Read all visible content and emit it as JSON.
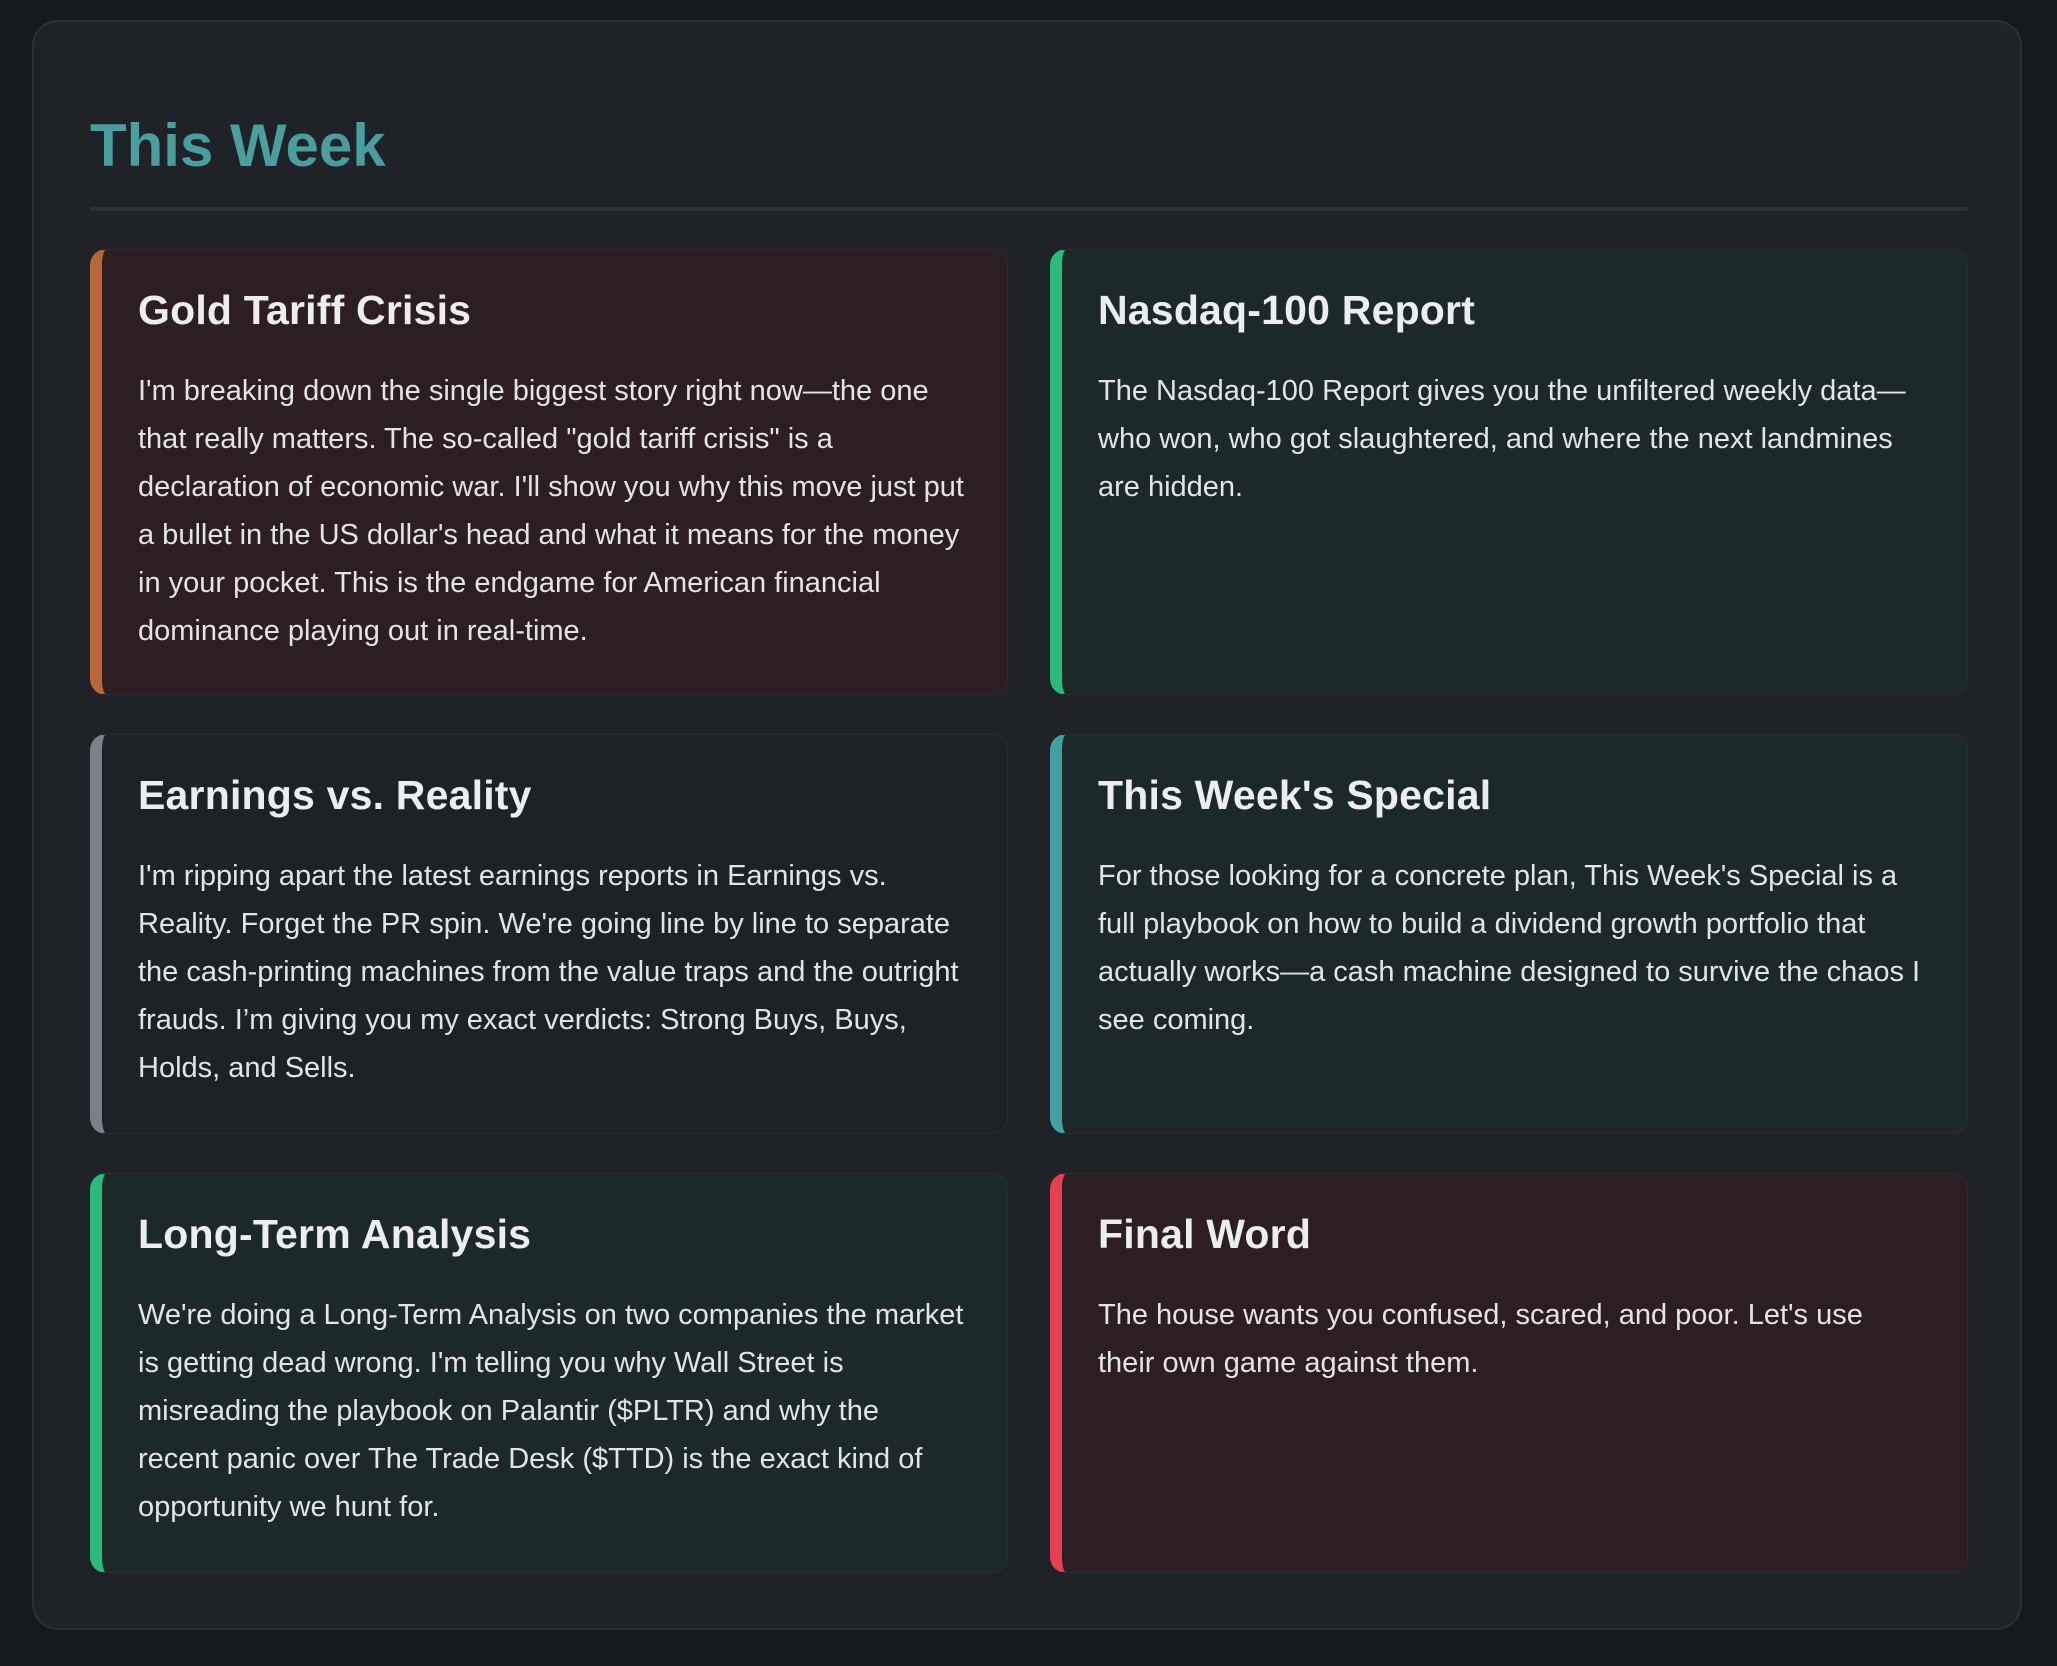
{
  "header": {
    "title": "This Week"
  },
  "colors": {
    "title": "#4a9e9e",
    "accent_orange": "#b8663c",
    "accent_green": "#2bb97c",
    "accent_grey": "#7b808a",
    "accent_teal": "#47a0a0",
    "accent_red": "#e43f55"
  },
  "cards": [
    {
      "title": "Gold Tariff Crisis",
      "body": "I'm breaking down the single biggest story right now—the one that really matters. The so-called \"gold tariff crisis\" is a declaration of economic war. I'll show you why this move just put a bullet in the US dollar's head and what it means for the money in your pocket. This is the endgame for American financial dominance playing out in real-time."
    },
    {
      "title": "Nasdaq-100 Report",
      "body": "The Nasdaq-100 Report gives you the unfiltered weekly data—who won, who got slaughtered, and where the next landmines are hidden."
    },
    {
      "title": "Earnings vs. Reality",
      "body": "I'm ripping apart the latest earnings reports in Earnings vs. Reality. Forget the PR spin. We're going line by line to separate the cash-printing machines from the value traps and the outright frauds. I’m giving you my exact verdicts: Strong Buys, Buys, Holds, and Sells."
    },
    {
      "title": "This Week's Special",
      "body": "For those looking for a concrete plan, This Week's Special is a full playbook on how to build a dividend growth portfolio that actually works—a cash machine designed to survive the chaos I see coming."
    },
    {
      "title": "Long-Term Analysis",
      "body": "We're doing a Long-Term Analysis on two companies the market is getting dead wrong. I'm telling you why Wall Street is misreading the playbook on Palantir ($PLTR) and why the recent panic over The Trade Desk ($TTD) is the exact kind of opportunity we hunt for."
    },
    {
      "title": "Final Word",
      "body": "The house wants you confused, scared, and poor. Let's use their own game against them."
    }
  ]
}
